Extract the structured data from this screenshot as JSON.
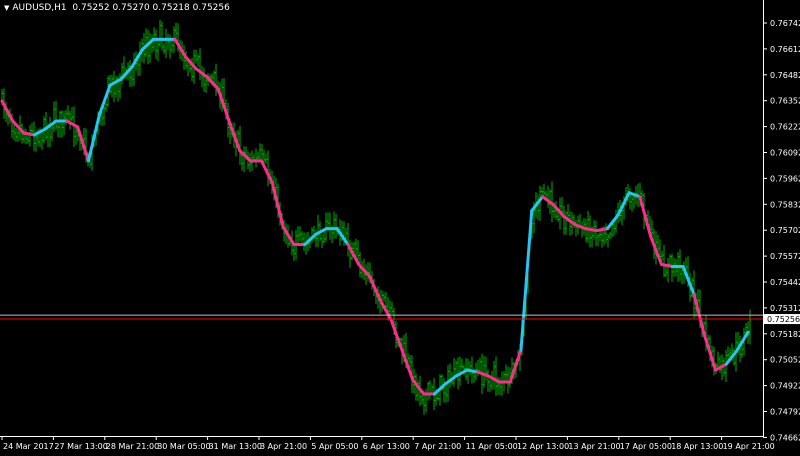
{
  "header": {
    "symbol": "AUDUSD,H1",
    "ohlc": "0.75252 0.75270 0.75218 0.75256"
  },
  "current_price_tag": "0.75256",
  "colors": {
    "background": "#000000",
    "bars": "#00b000",
    "ma_up": "#27c4f4",
    "ma_down": "#ff2a90",
    "bid_line": "#ff0000",
    "ask_line": "#c0c0c0",
    "axis": "#ffffff"
  },
  "chart_data": {
    "type": "line",
    "y_ticks": [
      "0.76742",
      "0.76612",
      "0.76482",
      "0.76352",
      "0.76222",
      "0.76092",
      "0.75962",
      "0.75832",
      "0.75702",
      "0.75572",
      "0.75442",
      "0.75312",
      "0.75182",
      "0.75052",
      "0.74922",
      "0.74792",
      "0.74662"
    ],
    "x_ticks": [
      "24 Mar 2017",
      "27 Mar 13:00",
      "28 Mar 21:00",
      "30 Mar 05:00",
      "31 Mar 13:00",
      "3 Apr 21:00",
      "5 Apr 05:00",
      "6 Apr 13:00",
      "7 Apr 21:00",
      "11 Apr 05:00",
      "12 Apr 13:00",
      "13 Apr 21:00",
      "17 Apr 05:00",
      "18 Apr 13:00",
      "19 Apr 21:00"
    ],
    "ylim": [
      0.7466,
      0.7682
    ],
    "bid": 0.75256,
    "ask": 0.75276,
    "series": [
      {
        "values": [
          0.7635,
          0.7625,
          0.7619,
          0.7618,
          0.7621,
          0.7625,
          0.7625,
          0.7622,
          0.7605,
          0.7628,
          0.7643,
          0.7646,
          0.7652,
          0.7661,
          0.7666,
          0.7666,
          0.7666,
          0.7657,
          0.7651,
          0.7647,
          0.7641,
          0.7625,
          0.761,
          0.7605,
          0.7605,
          0.7594,
          0.7572,
          0.7563,
          0.7563,
          0.7568,
          0.7571,
          0.7571,
          0.7563,
          0.7553,
          0.7547,
          0.7535,
          0.7525,
          0.751,
          0.7495,
          0.7488,
          0.7488,
          0.7493,
          0.7497,
          0.75,
          0.7499,
          0.7497,
          0.7494,
          0.7494,
          0.751,
          0.758,
          0.7587,
          0.7583,
          0.7577,
          0.7573,
          0.7571,
          0.757,
          0.7571,
          0.7578,
          0.7589,
          0.7587,
          0.7567,
          0.7553,
          0.7552,
          0.7552,
          0.7538,
          0.7517,
          0.75,
          0.7503,
          0.751,
          0.7519
        ],
        "trend": [
          "d",
          "d",
          "d",
          "u",
          "u",
          "u",
          "d",
          "d",
          "u",
          "u",
          "u",
          "u",
          "u",
          "u",
          "u",
          "u",
          "d",
          "d",
          "d",
          "d",
          "d",
          "d",
          "d",
          "d",
          "d",
          "d",
          "d",
          "d",
          "u",
          "u",
          "u",
          "u",
          "d",
          "d",
          "d",
          "d",
          "d",
          "d",
          "d",
          "d",
          "u",
          "u",
          "u",
          "u",
          "d",
          "d",
          "d",
          "d",
          "u",
          "u",
          "d",
          "d",
          "d",
          "d",
          "d",
          "d",
          "u",
          "u",
          "u",
          "d",
          "d",
          "d",
          "u",
          "u",
          "d",
          "d",
          "d",
          "u",
          "u",
          "u"
        ]
      }
    ]
  }
}
